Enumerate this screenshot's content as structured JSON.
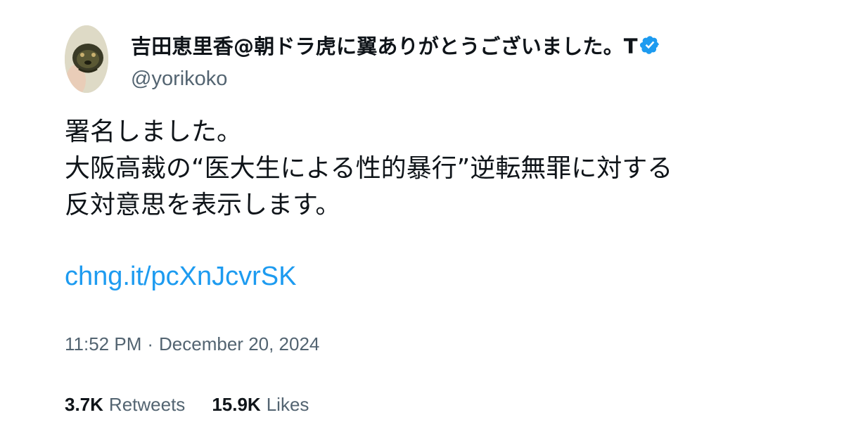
{
  "author": {
    "display_name": "吉田恵里香@朝ドラ虎に翼ありがとうございました。T",
    "handle": "@yorikoko",
    "verified_icon": "verified-badge-icon",
    "verified_color": "#1d9bf0"
  },
  "tweet": {
    "lines": [
      "署名しました。",
      "大阪高裁の“医大生による性的暴行”逆転無罪に対する",
      "反対意思を表示します。"
    ],
    "link_text": "chng.it/pcXnJcvrSK",
    "link_color": "#1d9bf0",
    "time": "11:52 PM",
    "separator": "·",
    "date": "December 20, 2024"
  },
  "stats": {
    "retweets_count": "3.7K",
    "retweets_label": "Retweets",
    "likes_count": "15.9K",
    "likes_label": "Likes"
  },
  "colors": {
    "text_primary": "#0f1419",
    "text_secondary": "#536471",
    "background": "#ffffff"
  }
}
